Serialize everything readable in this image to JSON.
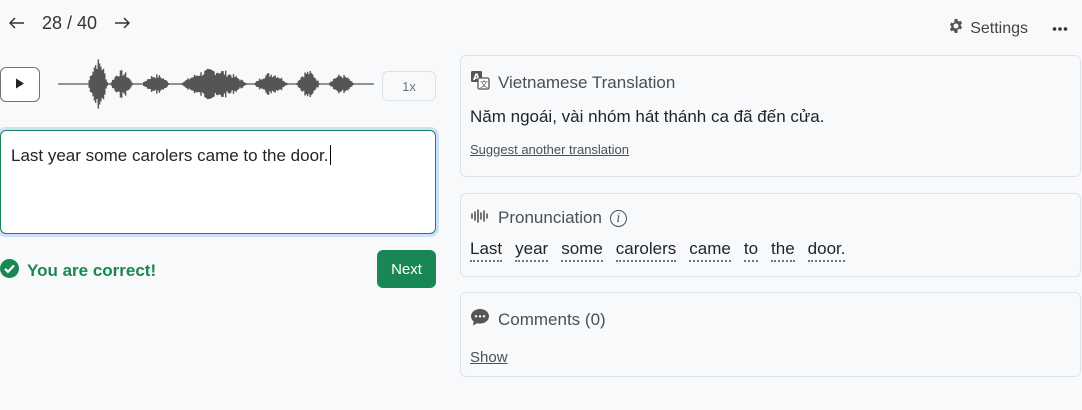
{
  "nav": {
    "counter": "28 / 40",
    "prev_icon": "arrow-left-icon",
    "next_icon": "arrow-right-icon"
  },
  "top": {
    "settings_label": "Settings",
    "settings_icon": "gear-icon",
    "more_icon": "more-horizontal-icon"
  },
  "audio": {
    "play_icon": "play-icon",
    "speed": "1x"
  },
  "answer": {
    "text": "Last year some carolers came to the door."
  },
  "feedback": {
    "message": "You are correct!",
    "icon": "check-circle-icon",
    "next_label": "Next"
  },
  "translation": {
    "title": "Vietnamese Translation",
    "text": "Năm ngoái, vài nhóm hát thánh ca đã đến cửa.",
    "suggest_label": "Suggest another translation",
    "icon": "translate-icon"
  },
  "pronunciation": {
    "title": "Pronunciation",
    "icon": "audio-wave-icon",
    "words": [
      "Last",
      "year",
      "some",
      "carolers",
      "came",
      "to",
      "the",
      "door."
    ]
  },
  "comments": {
    "title": "Comments (0)",
    "show_label": "Show",
    "icon": "chat-bubble-icon"
  },
  "colors": {
    "success": "#198754",
    "border": "#dee2e6",
    "background": "#f8f9fa"
  }
}
